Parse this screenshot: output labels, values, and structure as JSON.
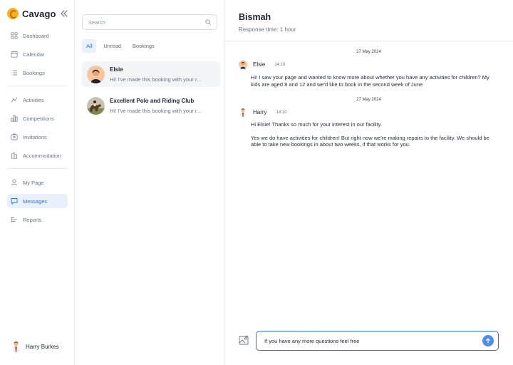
{
  "app": {
    "name": "Cavago",
    "accent": "#2f6fd8",
    "brand_color": "#f5b21b"
  },
  "sidebar": {
    "group1": [
      {
        "label": "Dashboard",
        "icon": "dashboard-icon"
      },
      {
        "label": "Calendar",
        "icon": "calendar-icon"
      },
      {
        "label": "Bookings",
        "icon": "bookings-list-icon"
      }
    ],
    "group2": [
      {
        "label": "Activities",
        "icon": "activities-icon"
      },
      {
        "label": "Competitions",
        "icon": "competitions-icon"
      },
      {
        "label": "Invitations",
        "icon": "invitations-icon"
      },
      {
        "label": "Accommodation",
        "icon": "accommodation-icon"
      }
    ],
    "group3": [
      {
        "label": "My Page",
        "icon": "user-icon"
      },
      {
        "label": "Messages",
        "icon": "message-icon",
        "active": true
      },
      {
        "label": "Reports",
        "icon": "reports-icon"
      }
    ],
    "user": {
      "name": "Harry Burkes"
    }
  },
  "inbox": {
    "search_placeholder": "Search",
    "filters": [
      "All",
      "Unread",
      "Bookings"
    ],
    "active_filter": "All",
    "conversations": [
      {
        "name": "Elsie",
        "preview": "Hi! I've made this booking with your r...",
        "active": true
      },
      {
        "name": "Excellent Polo and Riding Club",
        "preview": "Hi! I've made this booking with your r..."
      }
    ]
  },
  "chat": {
    "title": "Bismah",
    "subtitle": "Response time: 1 hour",
    "messages": [
      {
        "date": "27 May 2024",
        "sender": "Elsie",
        "time": "14:10",
        "paragraphs": [
          "Hi! I saw your page and wanted to know more about whether you have any activities for children? My kids are aged 8 and 12 and we'd like to book in the second week of June"
        ]
      },
      {
        "date": "27 May 2024",
        "sender": "Harry",
        "time": "14:10",
        "paragraphs": [
          "Hi Elsie! Thanks so much for your interest in our facility.",
          "Yes we do have activities for children! But right now we're making repairs to the facility. We should be able to take new bookings in about two weeks, if that works for you."
        ]
      }
    ],
    "composer_value": "If you have any more questions feel free"
  }
}
